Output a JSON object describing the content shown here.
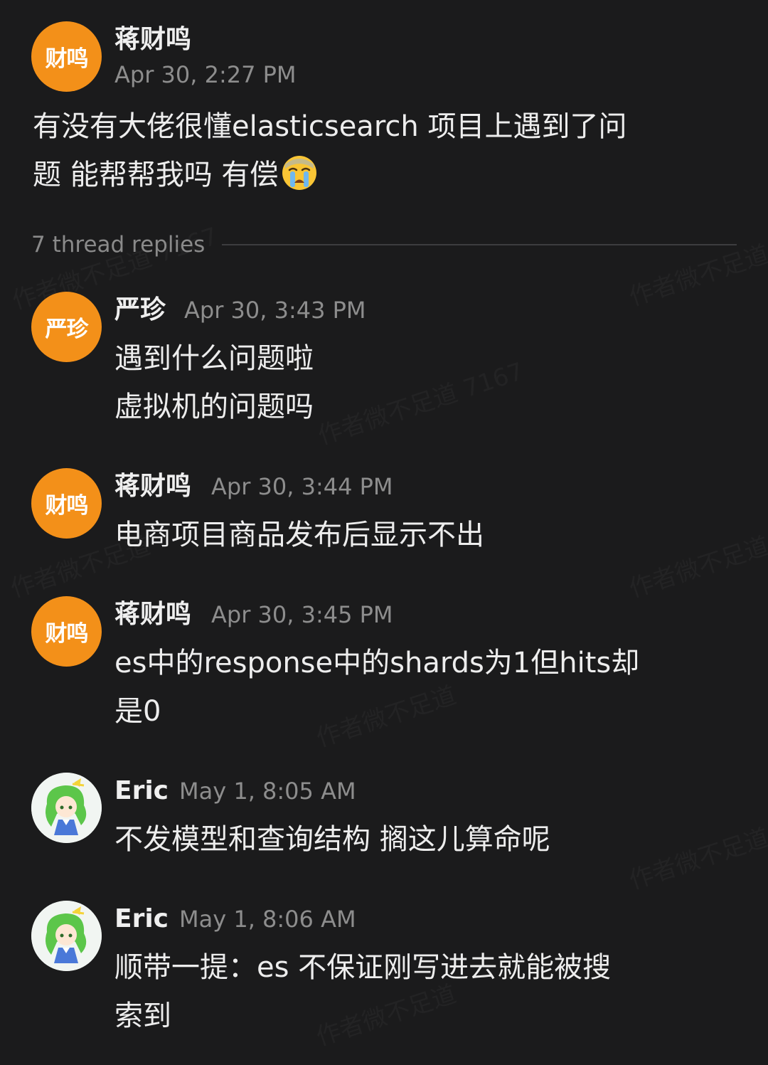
{
  "root_message": {
    "avatar_text": "财鸣",
    "author": "蒋财鸣",
    "timestamp": "Apr 30, 2:27 PM",
    "lines": [
      "有没有大佬很懂elasticsearch 项目上遇到了问",
      "题 能帮帮我吗 有偿"
    ],
    "emoji": "crying-face-emoji"
  },
  "thread": {
    "replies_label": "7 thread replies"
  },
  "replies": [
    {
      "avatar_text": "严珍",
      "author": "严珍",
      "timestamp": "Apr 30, 3:43 PM",
      "lines": [
        "遇到什么问题啦",
        "虚拟机的问题吗"
      ]
    },
    {
      "avatar_text": "财鸣",
      "author": "蒋财鸣",
      "timestamp": "Apr 30, 3:44 PM",
      "lines": [
        "电商项目商品发布后显示不出"
      ]
    },
    {
      "avatar_text": "财鸣",
      "author": "蒋财鸣",
      "timestamp": "Apr 30, 3:45 PM",
      "lines": [
        "es中的response中的shards为1但hits却",
        "是0"
      ]
    },
    {
      "avatar_icon": "anime-character-avatar",
      "author": "Eric",
      "timestamp": "May 1, 8:05 AM",
      "lines": [
        "不发模型和查询结构 搁这儿算命呢"
      ]
    },
    {
      "avatar_icon": "anime-character-avatar",
      "author": "Eric",
      "timestamp": "May 1, 8:06 AM",
      "lines": [
        "顺带一提：es 不保证刚写进去就能被搜",
        "索到"
      ]
    }
  ],
  "colors": {
    "background": "#1b1b1c",
    "avatar_orange": "#f39019",
    "text_primary": "#ededed",
    "text_secondary": "#8d8d8d"
  }
}
